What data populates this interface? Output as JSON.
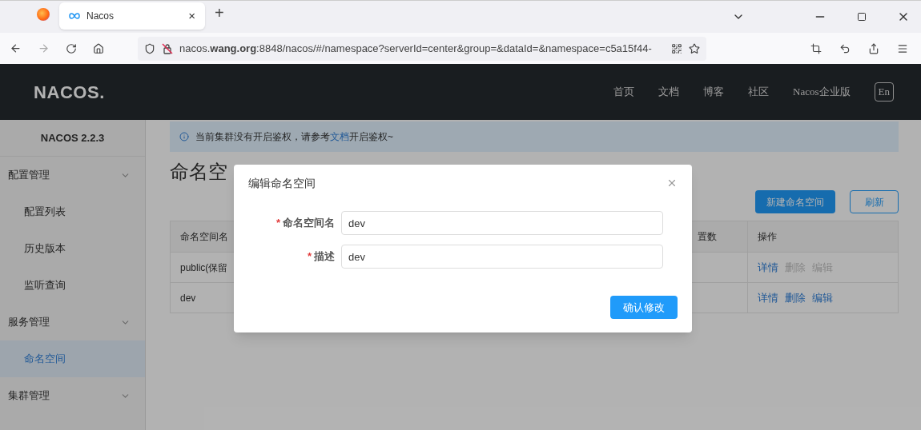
{
  "browser": {
    "tab": {
      "title": "Nacos",
      "close": "×"
    },
    "new_tab": "+",
    "url": "nacos.**wang.org**:8848/nacos/#/namespace?serverId=center&group=&dataId=&namespace=c5a15f44-"
  },
  "header": {
    "logo": "NACOS.",
    "nav": [
      "首页",
      "文档",
      "博客",
      "社区",
      "Nacos企业版"
    ],
    "lang": "En"
  },
  "sidebar": {
    "title": "NACOS 2.2.3",
    "items": [
      {
        "label": "配置管理",
        "kind": "group",
        "selected": false
      },
      {
        "label": "配置列表",
        "kind": "item",
        "selected": false
      },
      {
        "label": "历史版本",
        "kind": "item",
        "selected": false
      },
      {
        "label": "监听查询",
        "kind": "item",
        "selected": false
      },
      {
        "label": "服务管理",
        "kind": "group",
        "selected": false
      },
      {
        "label": "命名空间",
        "kind": "item",
        "selected": true
      },
      {
        "label": "集群管理",
        "kind": "group",
        "selected": false
      }
    ]
  },
  "alert": {
    "before": "当前集群没有开启鉴权，请参考",
    "link": "文档",
    "after": "开启鉴权~"
  },
  "page_title": "命名空",
  "buttons": {
    "create": "新建命名空间",
    "refresh": "刷新"
  },
  "table": {
    "columns": [
      "命名空间名",
      "置数",
      "操作"
    ],
    "rows": [
      {
        "name": "public(保留",
        "actions": [
          {
            "label": "详情",
            "disabled": false
          },
          {
            "label": "删除",
            "disabled": true
          },
          {
            "label": "编辑",
            "disabled": true
          }
        ]
      },
      {
        "name": "dev",
        "actions": [
          {
            "label": "详情",
            "disabled": false
          },
          {
            "label": "删除",
            "disabled": false
          },
          {
            "label": "编辑",
            "disabled": false
          }
        ]
      }
    ]
  },
  "dialog": {
    "title": "编辑命名空间",
    "fields": [
      {
        "label": "命名空间名",
        "required_mark": "*",
        "value": "dev"
      },
      {
        "label": "描述",
        "required_mark": "*",
        "value": "dev"
      }
    ],
    "confirm": "确认修改"
  }
}
